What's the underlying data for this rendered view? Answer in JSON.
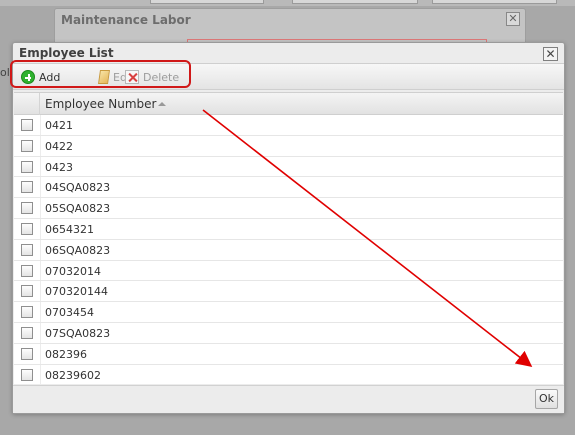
{
  "background": {
    "dialog_title": "Maintenance Labor",
    "close_glyph": "✕",
    "left_edge_text": "ol"
  },
  "dialog": {
    "title": "Employee List",
    "close_glyph": "✕",
    "toolbar": {
      "add_label": "Add",
      "edit_label": "Edit",
      "delete_label": "Delete",
      "add_icon": "add-circle-icon",
      "edit_icon": "pencil-icon",
      "delete_icon": "delete-x-icon"
    },
    "grid": {
      "column_header": "Employee Number",
      "sort_direction": "ascending",
      "rows": [
        "0421",
        "0422",
        "0423",
        "04SQA0823",
        "05SQA0823",
        "0654321",
        "06SQA0823",
        "07032014",
        "070320144",
        "0703454",
        "07SQA0823",
        "082396",
        "08239602"
      ]
    },
    "ok_label": "Ok"
  },
  "annotation": {
    "highlight_color": "#d01818",
    "arrow_color": "#e00000"
  }
}
